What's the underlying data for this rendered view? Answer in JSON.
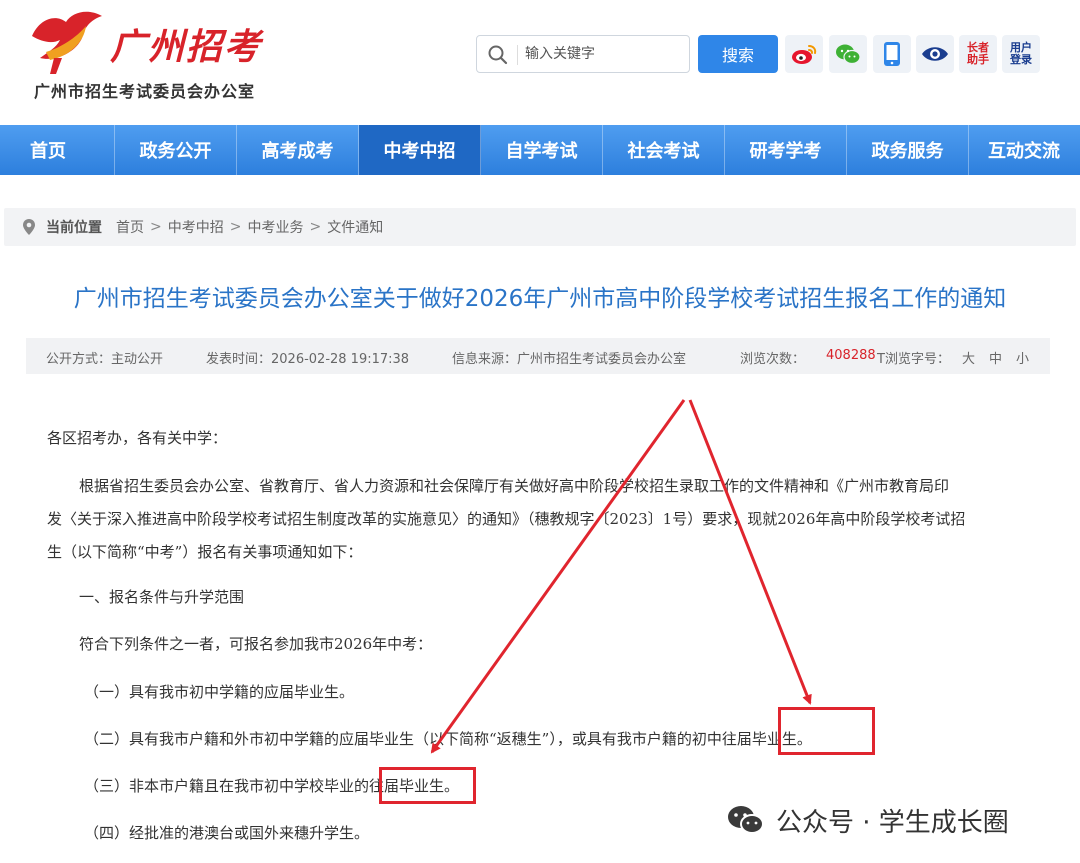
{
  "header": {
    "logo_title": "广州招考",
    "logo_subtitle": "广州市招生考试委员会办公室",
    "search": {
      "placeholder": "输入关键字",
      "button_label": "搜索"
    },
    "tools": [
      {
        "name": "weibo-icon"
      },
      {
        "name": "wechat-icon"
      },
      {
        "name": "mobile-icon"
      },
      {
        "name": "eye-icon"
      },
      {
        "name": "elder-assistant-icon",
        "label_line1": "长者",
        "label_line2": "助手"
      },
      {
        "name": "user-login-icon",
        "label_line1": "用户",
        "label_line2": "登录"
      }
    ]
  },
  "nav": {
    "items": [
      "首页",
      "政务公开",
      "高考成考",
      "中考中招",
      "自学考试",
      "社会考试",
      "研考学考",
      "政务服务",
      "互动交流"
    ],
    "active_index": 3
  },
  "breadcrumb": {
    "lead": "当前位置",
    "items": [
      "首页",
      "中考中招",
      "中考业务",
      "文件通知"
    ],
    "separator": ">"
  },
  "article": {
    "title": "广州市招生考试委员会办公室关于做好2026年广州市高中阶段学校考试招生报名工作的通知",
    "meta": {
      "publish_mode": "公开方式：主动公开",
      "publish_time": "发表时间：2026-02-28 19:17:38",
      "source": "信息来源：广州市招生考试委员会办公室",
      "views_label": "浏览次数：",
      "views_value": "408288",
      "font_size_label": "T浏览字号：",
      "font_sizes": [
        "大",
        "中",
        "小"
      ]
    },
    "salutation": "各区招考办，各有关中学：",
    "intro_line1": "根据省招生委员会办公室、省教育厅、省人力资源和社会保障厅有关做好高中阶段学校招生录取工作的文件精神和《广州市教育局印",
    "intro_line2": "发〈关于深入推进高中阶段学校考试招生制度改革的实施意见〉的通知》（穗教规字〔2023〕1号）要求，现就2026年高中阶段学校考试招",
    "intro_line3": "生（以下简称“中考”）报名有关事项通知如下：",
    "section1": "一、报名条件与升学范围",
    "condition_intro": "符合下列条件之一者，可报名参加我市2026年中考：",
    "conditions": [
      "（一）具有我市初中学籍的应届毕业生。",
      "（二）具有我市户籍和外市初中学籍的应届毕业生（以下简称“返穗生”），或具有我市户籍的初中往届毕业生。",
      "（三）非本市户籍且在我市初中学校毕业的往届毕业生。",
      "（四）经批准的港澳台或国外来穗升学生。"
    ]
  },
  "watermark": "公众号 · 学生成长圈",
  "colors": {
    "brand_red": "#d8232a",
    "nav_blue": "#2d7fdd",
    "title_blue": "#2a74c7",
    "annotation_red": "#e0252e"
  }
}
